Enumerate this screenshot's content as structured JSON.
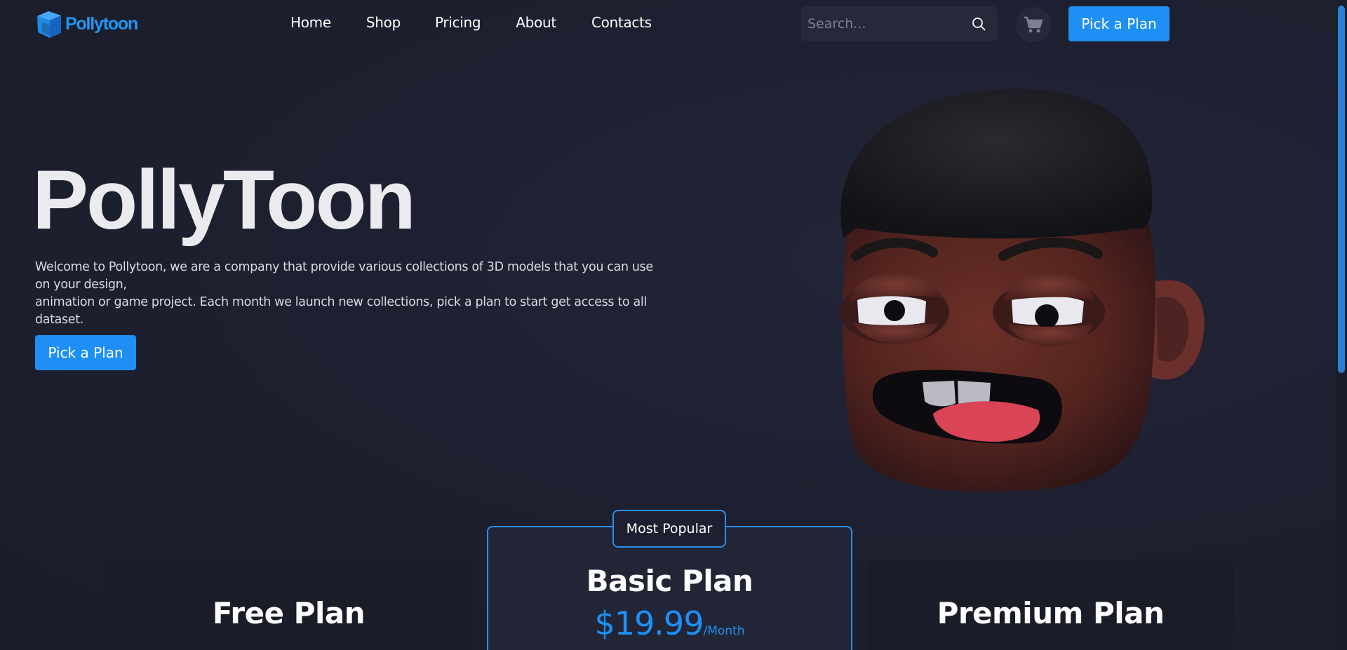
{
  "brand": {
    "name": "Pollytoon",
    "color": "#2196f3"
  },
  "nav": {
    "items": [
      {
        "label": "Home"
      },
      {
        "label": "Shop"
      },
      {
        "label": "Pricing"
      },
      {
        "label": "About"
      },
      {
        "label": "Contacts"
      }
    ]
  },
  "search": {
    "placeholder": "Search...",
    "icon": "search-icon"
  },
  "cart": {
    "icon": "cart-icon"
  },
  "header": {
    "cta_label": "Pick a Plan"
  },
  "hero": {
    "title": "PollyToon",
    "description_line1": "Welcome to Pollytoon, we are a company that provide various collections of 3D models that you can use on your design,",
    "description_line2": "animation or game project. Each month we launch new collections, pick a plan to start get access to all dataset.",
    "cta_label": "Pick a Plan"
  },
  "pricing": {
    "badge": "Most Popular",
    "plans": [
      {
        "name": "Free Plan"
      },
      {
        "name": "Basic Plan",
        "price": "$19.99",
        "unit": "/Month"
      },
      {
        "name": "Premium Plan"
      }
    ]
  },
  "colors": {
    "accent": "#1e90f5",
    "background": "#1c1f2c"
  }
}
